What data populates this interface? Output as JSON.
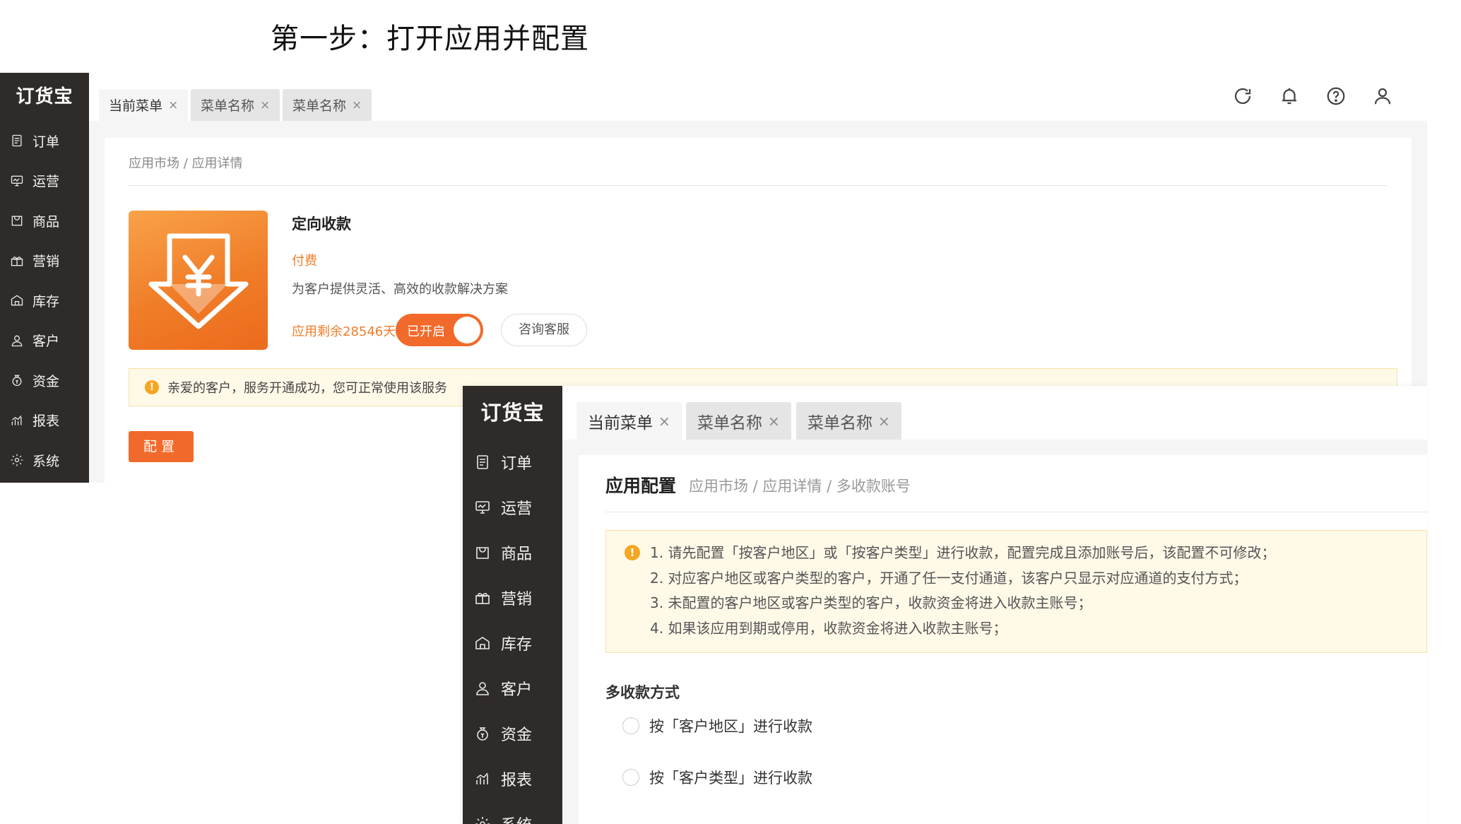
{
  "step_title": "第一步：打开应用并配置",
  "logo_text": "订货宝",
  "nav_items": [
    {
      "label": "订单",
      "icon": "order-icon"
    },
    {
      "label": "运营",
      "icon": "operations-icon"
    },
    {
      "label": "商品",
      "icon": "goods-icon"
    },
    {
      "label": "营销",
      "icon": "gift-icon"
    },
    {
      "label": "库存",
      "icon": "warehouse-icon"
    },
    {
      "label": "客户",
      "icon": "user-icon"
    },
    {
      "label": "资金",
      "icon": "money-bag-icon"
    },
    {
      "label": "报表",
      "icon": "chart-icon"
    },
    {
      "label": "系统",
      "icon": "gear-icon"
    }
  ],
  "tabs": [
    {
      "label": "当前菜单",
      "close": "×"
    },
    {
      "label": "菜单名称",
      "close": "×"
    },
    {
      "label": "菜单名称",
      "close": "×"
    }
  ],
  "toolbar_icons": [
    "refresh-icon",
    "bell-icon",
    "help-icon",
    "user-icon"
  ],
  "detail": {
    "breadcrumb": "应用市场 / 应用详情",
    "app_name": "定向收款",
    "price": "付费",
    "description": "为客户提供灵活、高效的收款解决方案",
    "remaining": "应用剩余28546天",
    "toggle_label": "已开启",
    "consult_button": "咨询客服",
    "notice": "亲爱的客户，服务开通成功，您可正常使用该服务",
    "config_button": "配置"
  },
  "config_page": {
    "title": "应用配置",
    "breadcrumb": "应用市场 / 应用详情 / 多收款账号",
    "notice_lines": [
      "1. 请先配置「按客户地区」或「按客户类型」进行收款，配置完成且添加账号后，该配置不可修改；",
      "2. 对应客户地区或客户类型的客户，开通了任一支付通道，该客户只显示对应通道的支付方式；",
      "3. 未配置的客户地区或客户类型的客户，收款资金将进入收款主账号；",
      "4. 如果该应用到期或停用，收款资金将进入收款主账号；"
    ],
    "section_label": "多收款方式",
    "options": [
      {
        "label": "按「客户地区」进行收款",
        "selected": false
      },
      {
        "label": "按「客户类型」进行收款",
        "selected": false
      }
    ]
  },
  "colors": {
    "accent": "#f26a2b",
    "sidebar": "#2f2b29",
    "notice_bg": "#fff9e8",
    "warn": "#f5a623"
  }
}
